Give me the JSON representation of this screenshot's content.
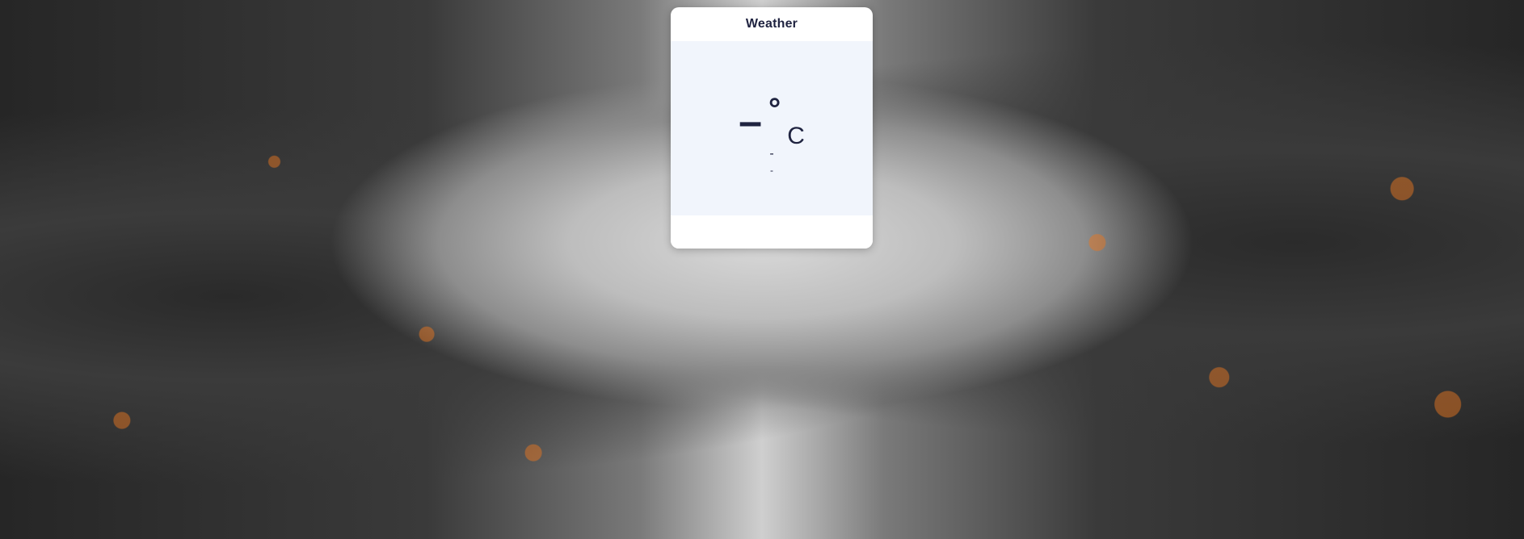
{
  "widget": {
    "title": "Weather",
    "temperature": "–",
    "degree_symbol": "°",
    "unit": "C",
    "condition": "-",
    "location": "-"
  },
  "background": {
    "description": "",
    "accent": "#e87620"
  }
}
